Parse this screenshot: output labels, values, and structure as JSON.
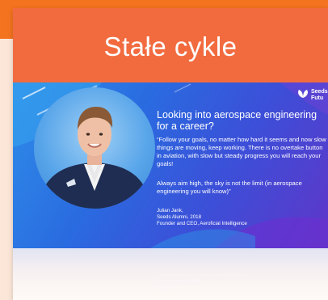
{
  "card": {
    "title": "Stałe cykle"
  },
  "banner": {
    "logo_name": "Seeds of the Future",
    "logo_line1": "Seeds",
    "logo_line2": "Futu",
    "headline": "Looking into aerospace engineering for a career?",
    "quote": "“Follow your goals, no matter how hard it seems and now slow things are moving, keep working. There is no overtake button in aviation, with slow but steady progress you will reach your goals!",
    "quote_2": "Always aim high, the sky is not the limit (in aerospace engineering you will know)”",
    "name": "Julian Jank,",
    "role": "Seeds Alumni, 2018",
    "position": "Founder and CEO, Aeroficial Intelligence"
  },
  "colors": {
    "top_band": "#f4731f",
    "header": "#f26b3f",
    "banner_start": "#2e8de9",
    "banner_end": "#5f36c9"
  },
  "icons": {
    "logo": "seeds-leaf-icon",
    "photo": "person-portrait"
  }
}
